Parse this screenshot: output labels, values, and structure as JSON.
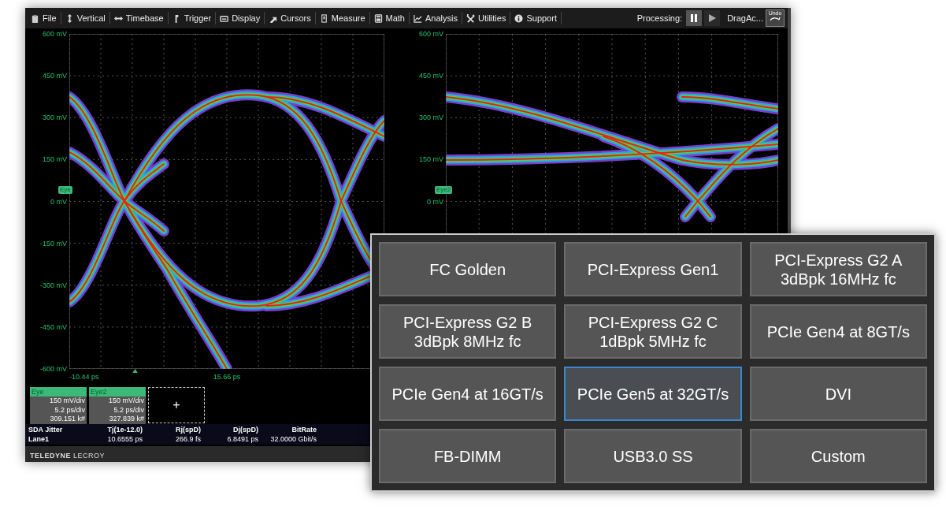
{
  "menu": [
    {
      "label": "File"
    },
    {
      "label": "Vertical"
    },
    {
      "label": "Timebase"
    },
    {
      "label": "Trigger"
    },
    {
      "label": "Display"
    },
    {
      "label": "Cursors"
    },
    {
      "label": "Measure"
    },
    {
      "label": "Math"
    },
    {
      "label": "Analysis"
    },
    {
      "label": "Utilities"
    },
    {
      "label": "Support"
    }
  ],
  "processing": {
    "label": "Processing:",
    "status": "DragAc...",
    "undo": "Undo"
  },
  "plots": [
    {
      "trace_tag": "Eye",
      "y_labels": [
        "600 mV",
        "450 mV",
        "300 mV",
        "150 mV",
        "0 mV",
        "-150 mV",
        "-300 mV",
        "-450 mV",
        "-600 mV"
      ],
      "x_labels": [
        "-10.44 ps",
        "15.66 ps"
      ]
    },
    {
      "trace_tag": "Eye2",
      "y_labels": [
        "600 mV",
        "450 mV",
        "300 mV",
        "150 mV",
        "0 mV"
      ]
    }
  ],
  "descriptors": [
    {
      "name": "Eye",
      "lines": [
        "150 mV/div",
        "5.2 ps/div",
        "309.151 k#"
      ]
    },
    {
      "name": "Eye2",
      "lines": [
        "150 mV/div",
        "5.2 ps/div",
        "327.839 k#"
      ]
    }
  ],
  "add_label": "+",
  "measurements": {
    "columns": [
      "SDA Jitter",
      "Tj(1e-12.0)",
      "Rj(spD)",
      "Dj(spD)",
      "BitRate"
    ],
    "rows": [
      [
        "Lane1",
        "10.6555 ps",
        "266.9 fs",
        "6.8491 ps",
        "32.0000 Gbit/s"
      ]
    ]
  },
  "brand": "**TELEDYNE** LECROY",
  "presets": [
    {
      "label": "FC Golden",
      "selected": false
    },
    {
      "label": "PCI-Express Gen1",
      "selected": false
    },
    {
      "label": "PCI-Express G2 A 3dBpk 16MHz fc",
      "selected": false
    },
    {
      "label": "PCI-Express G2 B 3dBpk 8MHz fc",
      "selected": false
    },
    {
      "label": "PCI-Express G2 C 1dBpk 5MHz fc",
      "selected": false
    },
    {
      "label": "PCIe Gen4 at 8GT/s",
      "selected": false
    },
    {
      "label": "PCIe Gen4 at 16GT/s",
      "selected": false
    },
    {
      "label": "PCIe Gen5 at 32GT/s",
      "selected": true
    },
    {
      "label": "DVI",
      "selected": false
    },
    {
      "label": "FB-DIMM",
      "selected": false
    },
    {
      "label": "USB3.0 SS",
      "selected": false
    },
    {
      "label": "Custom",
      "selected": false
    }
  ]
}
